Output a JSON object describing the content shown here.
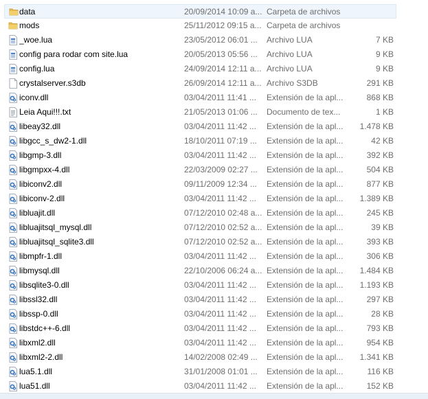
{
  "colors": {
    "folder": "#e8bd52",
    "folder_dark": "#c99a2e",
    "dll_blue": "#3a78c2",
    "secondary_text": "#6d6d6d"
  },
  "files": [
    {
      "name": "data",
      "date": "20/09/2014 10:09 a...",
      "type": "Carpeta de archivos",
      "size": "",
      "icon": "folder-icon",
      "selected": true
    },
    {
      "name": "mods",
      "date": "25/11/2012 09:15 a...",
      "type": "Carpeta de archivos",
      "size": "",
      "icon": "folder-icon"
    },
    {
      "name": "_woe.lua",
      "date": "23/05/2012 06:01 ...",
      "type": "Archivo LUA",
      "size": "7 KB",
      "icon": "lua-file-icon"
    },
    {
      "name": "config para rodar com site.lua",
      "date": "20/05/2013 05:56 ...",
      "type": "Archivo LUA",
      "size": "9 KB",
      "icon": "lua-file-icon"
    },
    {
      "name": "config.lua",
      "date": "24/09/2014 12:11 a...",
      "type": "Archivo LUA",
      "size": "9 KB",
      "icon": "lua-file-icon"
    },
    {
      "name": "crystalserver.s3db",
      "date": "26/09/2014 12:11 a...",
      "type": "Archivo S3DB",
      "size": "291 KB",
      "icon": "blank-file-icon"
    },
    {
      "name": "iconv.dll",
      "date": "03/04/2011 11:41 ...",
      "type": "Extensión de la apl...",
      "size": "868 KB",
      "icon": "dll-file-icon"
    },
    {
      "name": "Leia Aqui!!!.txt",
      "date": "21/05/2013 01:06 ...",
      "type": "Documento de tex...",
      "size": "1 KB",
      "icon": "text-file-icon"
    },
    {
      "name": "libeay32.dll",
      "date": "03/04/2011 11:42 ...",
      "type": "Extensión de la apl...",
      "size": "1.478 KB",
      "icon": "dll-file-icon"
    },
    {
      "name": "libgcc_s_dw2-1.dll",
      "date": "18/10/2011 07:19 ...",
      "type": "Extensión de la apl...",
      "size": "42 KB",
      "icon": "dll-file-icon"
    },
    {
      "name": "libgmp-3.dll",
      "date": "03/04/2011 11:42 ...",
      "type": "Extensión de la apl...",
      "size": "392 KB",
      "icon": "dll-file-icon"
    },
    {
      "name": "libgmpxx-4.dll",
      "date": "22/03/2009 02:27 ...",
      "type": "Extensión de la apl...",
      "size": "504 KB",
      "icon": "dll-file-icon"
    },
    {
      "name": "libiconv2.dll",
      "date": "09/11/2009 12:34 ...",
      "type": "Extensión de la apl...",
      "size": "877 KB",
      "icon": "dll-file-icon"
    },
    {
      "name": "libiconv-2.dll",
      "date": "03/04/2011 11:42 ...",
      "type": "Extensión de la apl...",
      "size": "1.389 KB",
      "icon": "dll-file-icon"
    },
    {
      "name": "libluajit.dll",
      "date": "07/12/2010 02:48 a...",
      "type": "Extensión de la apl...",
      "size": "245 KB",
      "icon": "dll-file-icon"
    },
    {
      "name": "libluajitsql_mysql.dll",
      "date": "07/12/2010 02:52 a...",
      "type": "Extensión de la apl...",
      "size": "39 KB",
      "icon": "dll-file-icon"
    },
    {
      "name": "libluajitsql_sqlite3.dll",
      "date": "07/12/2010 02:52 a...",
      "type": "Extensión de la apl...",
      "size": "393 KB",
      "icon": "dll-file-icon"
    },
    {
      "name": "libmpfr-1.dll",
      "date": "03/04/2011 11:42 ...",
      "type": "Extensión de la apl...",
      "size": "306 KB",
      "icon": "dll-file-icon"
    },
    {
      "name": "libmysql.dll",
      "date": "22/10/2006 06:24 a...",
      "type": "Extensión de la apl...",
      "size": "1.484 KB",
      "icon": "dll-file-icon"
    },
    {
      "name": "libsqlite3-0.dll",
      "date": "03/04/2011 11:42 ...",
      "type": "Extensión de la apl...",
      "size": "1.193 KB",
      "icon": "dll-file-icon"
    },
    {
      "name": "libssl32.dll",
      "date": "03/04/2011 11:42 ...",
      "type": "Extensión de la apl...",
      "size": "297 KB",
      "icon": "dll-file-icon"
    },
    {
      "name": "libssp-0.dll",
      "date": "03/04/2011 11:42 ...",
      "type": "Extensión de la apl...",
      "size": "28 KB",
      "icon": "dll-file-icon"
    },
    {
      "name": "libstdc++-6.dll",
      "date": "03/04/2011 11:42 ...",
      "type": "Extensión de la apl...",
      "size": "793 KB",
      "icon": "dll-file-icon"
    },
    {
      "name": "libxml2.dll",
      "date": "03/04/2011 11:42 ...",
      "type": "Extensión de la apl...",
      "size": "954 KB",
      "icon": "dll-file-icon"
    },
    {
      "name": "libxml2-2.dll",
      "date": "14/02/2008 02:49 ...",
      "type": "Extensión de la apl...",
      "size": "1.341 KB",
      "icon": "dll-file-icon"
    },
    {
      "name": "lua5.1.dll",
      "date": "31/01/2008 01:01 ...",
      "type": "Extensión de la apl...",
      "size": "116 KB",
      "icon": "dll-file-icon"
    },
    {
      "name": "lua51.dll",
      "date": "03/04/2011 11:42 ...",
      "type": "Extensión de la apl...",
      "size": "152 KB",
      "icon": "dll-file-icon"
    }
  ]
}
